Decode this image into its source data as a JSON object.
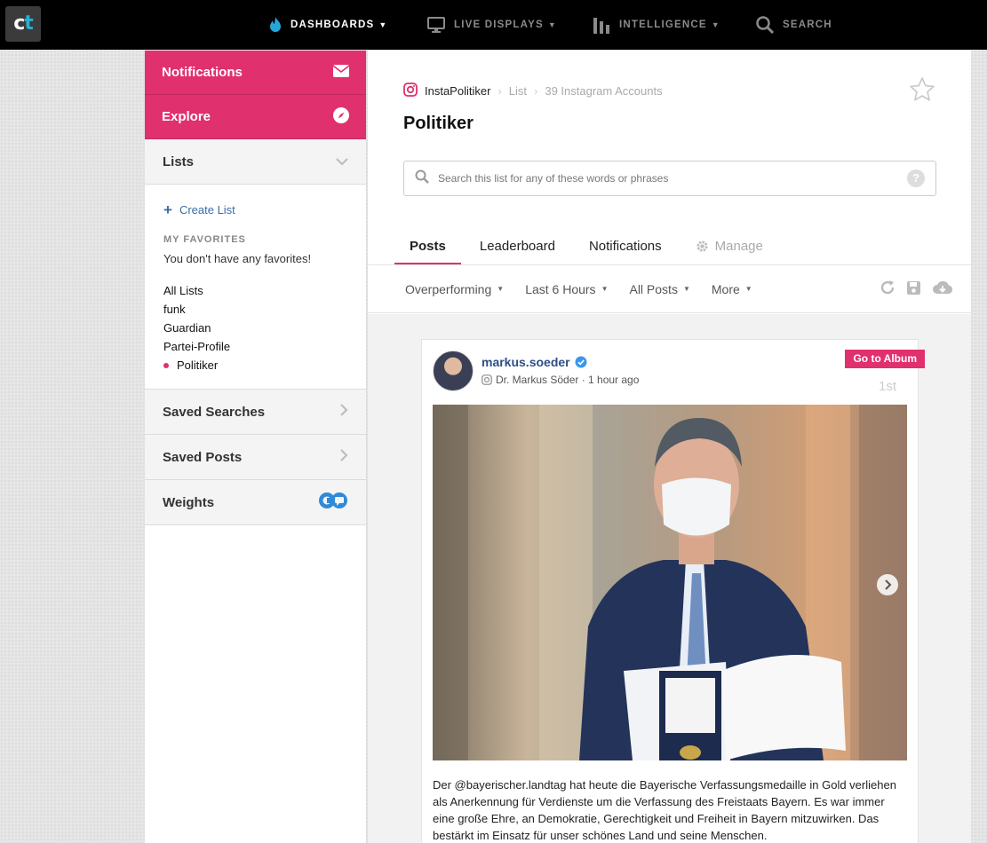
{
  "app": {
    "logo_text": "ct",
    "nav": [
      {
        "label": "DASHBOARDS",
        "icon": "flame-icon",
        "active": true
      },
      {
        "label": "LIVE DISPLAYS",
        "icon": "monitor-icon",
        "active": false
      },
      {
        "label": "INTELLIGENCE",
        "icon": "bar-chart-icon",
        "active": false
      },
      {
        "label": "SEARCH",
        "icon": "search-icon",
        "active": false
      }
    ]
  },
  "sidebar": {
    "notifications": "Notifications",
    "explore": "Explore",
    "lists": "Lists",
    "create_list": "Create List",
    "favorites_header": "MY FAVORITES",
    "favorites_empty": "You don't have any favorites!",
    "list_items": [
      "All Lists",
      "funk",
      "Guardian",
      "Partei-Profile",
      "Politiker"
    ],
    "selected_list": "Politiker",
    "saved_searches": "Saved Searches",
    "saved_posts": "Saved Posts",
    "weights": "Weights"
  },
  "breadcrumb": {
    "dashboard": "InstaPolitiker",
    "type": "List",
    "accounts": "39 Instagram Accounts"
  },
  "page_title": "Politiker",
  "search": {
    "placeholder": "Search this list for any of these words or phrases"
  },
  "tabs": [
    "Posts",
    "Leaderboard",
    "Notifications",
    "Manage"
  ],
  "active_tab": "Posts",
  "filters": [
    "Overperforming",
    "Last 6 Hours",
    "All Posts",
    "More"
  ],
  "post": {
    "handle": "markus.soeder",
    "name": "Dr. Markus Söder",
    "time": "1 hour ago",
    "subline": "Dr. Markus Söder · 1 hour ago",
    "album_button": "Go to Album",
    "rank": "1st",
    "text": "Der @bayerischer.landtag hat heute die Bayerische Verfassungsmedaille in Gold verliehen als Anerkennung für Verdienste um die Verfassung des Freistaats Bayern. Es war immer eine große Ehre, an Demokratie, Gerechtigkeit und Freiheit in Bayern mitzuwirken. Das bestärkt im Einsatz für unser schönes Land und seine Menschen."
  },
  "colors": {
    "accent": "#e0306d",
    "link": "#2c4f86",
    "topbar": "#000000"
  }
}
